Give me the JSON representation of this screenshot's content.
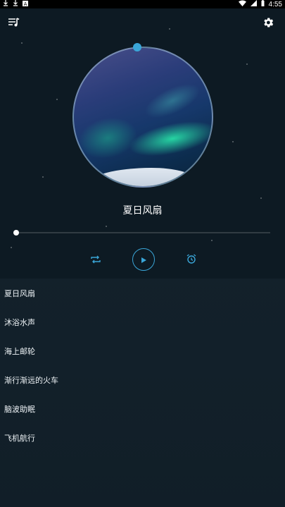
{
  "status_bar": {
    "time": "4:55",
    "left_icons": [
      "download-icon",
      "download-icon",
      "notification-icon"
    ],
    "right_icons": [
      "wifi-icon",
      "signal-icon",
      "battery-icon"
    ]
  },
  "header": {
    "left_icon": "playlist-icon",
    "right_icon": "gear-icon"
  },
  "player": {
    "song_title": "夏日风扇",
    "progress": 0.0,
    "controls": {
      "repeat_icon": "repeat-icon",
      "play_icon": "play-icon",
      "alarm_icon": "alarm-icon"
    }
  },
  "playlist": {
    "items": [
      {
        "label": "夏日风扇"
      },
      {
        "label": "沐浴水声"
      },
      {
        "label": "海上邮轮"
      },
      {
        "label": "渐行渐远的火车"
      },
      {
        "label": "脑波助眠"
      },
      {
        "label": "飞机航行"
      }
    ]
  },
  "colors": {
    "background": "#0d1a23",
    "accent": "#3aa6d8"
  }
}
